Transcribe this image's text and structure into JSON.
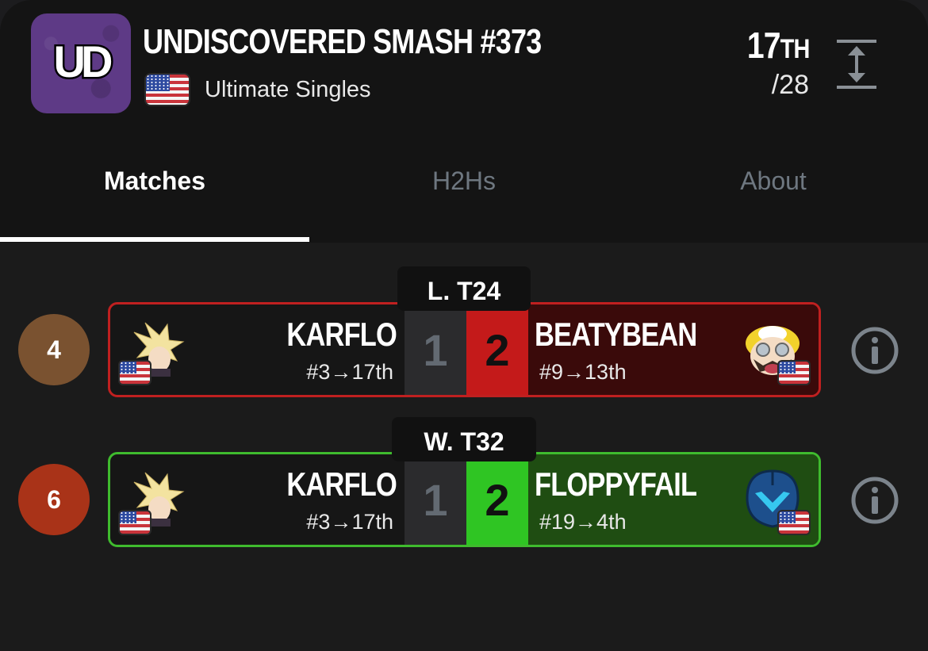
{
  "header": {
    "logo_text": "UD",
    "title": "UNDISCOVERED SMASH #373",
    "subtitle": "Ultimate Singles",
    "placement": "17",
    "placement_suffix": "TH",
    "total": "/28"
  },
  "tabs": [
    {
      "label": "Matches",
      "active": true
    },
    {
      "label": "H2Hs",
      "active": false
    },
    {
      "label": "About",
      "active": false
    }
  ],
  "matches": [
    {
      "round": "L. T24",
      "seed": "4",
      "seed_color": "#7a5230",
      "result": "loss",
      "left": {
        "name": "KARFLO",
        "progress": "#3→17th",
        "score": "1",
        "character_icon": "cloud-icon"
      },
      "right": {
        "name": "BEATYBEAN",
        "progress": "#9→13th",
        "score": "2",
        "character_icon": "wario-icon"
      }
    },
    {
      "round": "W. T32",
      "seed": "6",
      "seed_color": "#a93318",
      "result": "win",
      "left": {
        "name": "KARFLO",
        "progress": "#3→17th",
        "score": "1",
        "character_icon": "cloud-icon"
      },
      "right": {
        "name": "FLOPPYFAIL",
        "progress": "#19→4th",
        "score": "2",
        "character_icon": "samus-icon"
      }
    }
  ],
  "colors": {
    "loss_bg": "#3a0a0a",
    "loss_score": "#c41a1a",
    "loss_border": "#c02020",
    "win_bg": "#1f4d12",
    "win_score": "#2fc523",
    "win_border": "#3fbb2e",
    "logo_purple": "#5e3a86"
  }
}
